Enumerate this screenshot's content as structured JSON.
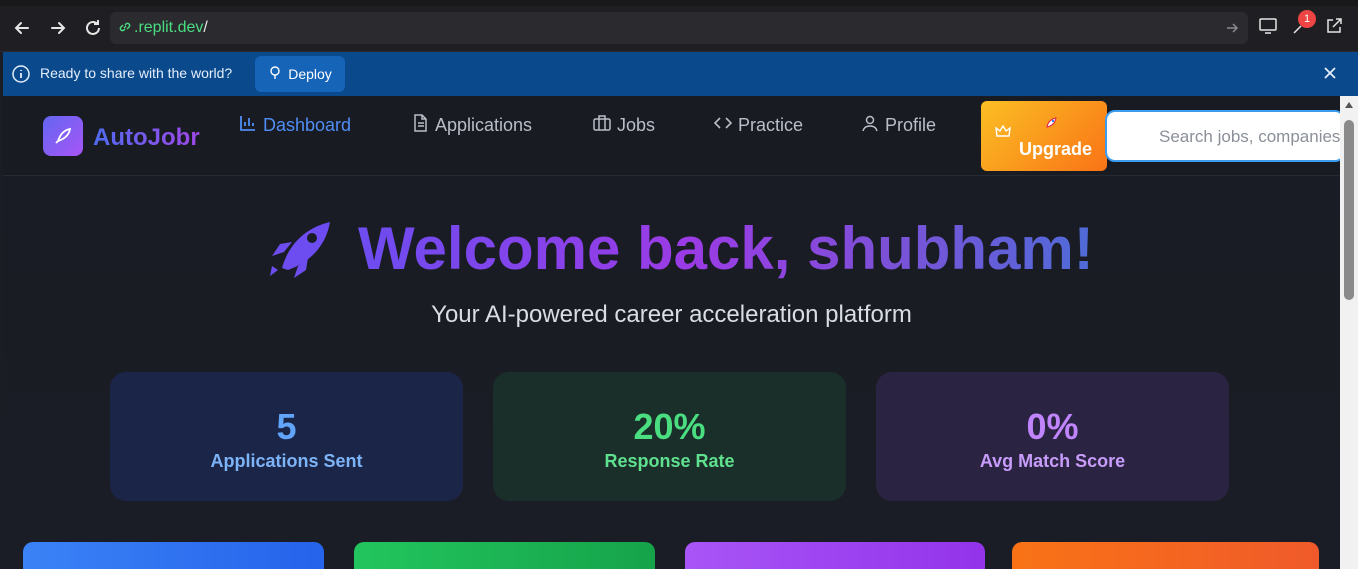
{
  "browser": {
    "url_host": ".replit.dev",
    "url_path": "/",
    "badge_count": "1"
  },
  "deploy_bar": {
    "message": "Ready to share with the world?",
    "deploy_label": "Deploy"
  },
  "header": {
    "logo": "AutoJobr",
    "nav": [
      {
        "label": "Dashboard",
        "icon": "bar-chart-icon",
        "active": true
      },
      {
        "label": "Applications",
        "icon": "document-icon"
      },
      {
        "label": "Jobs",
        "icon": "briefcase-icon"
      },
      {
        "label": "Practice",
        "icon": "code-icon"
      },
      {
        "label": "Profile",
        "icon": "user-icon"
      }
    ],
    "upgrade_label": "Upgrade",
    "search_placeholder": "Search jobs, companies"
  },
  "hero": {
    "title": "Welcome back, shubham!",
    "subtitle": "Your AI-powered career acceleration platform"
  },
  "stats": [
    {
      "value": "5",
      "label": "Applications Sent",
      "color": "#60a5fa"
    },
    {
      "value": "20%",
      "label": "Response Rate",
      "color": "#4ade80"
    },
    {
      "value": "0%",
      "label": "Avg Match Score",
      "color": "#c084fc"
    }
  ],
  "colors": {
    "accent": "#4f8df5",
    "upgrade_start": "#fbbf24",
    "upgrade_end": "#f97316",
    "deploy_bar": "#0a4a8c"
  }
}
